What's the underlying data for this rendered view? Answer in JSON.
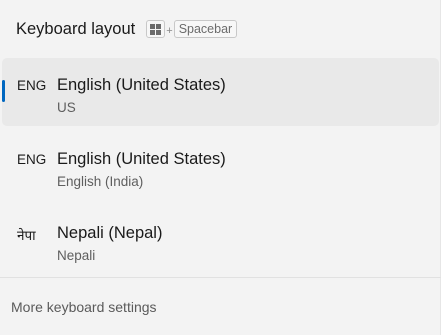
{
  "header": {
    "title": "Keyboard layout",
    "shortcut_plus": "+",
    "shortcut_key": "Spacebar"
  },
  "layouts": [
    {
      "code": "ENG",
      "name": "English (United States)",
      "sub": "US",
      "selected": true
    },
    {
      "code": "ENG",
      "name": "English (United States)",
      "sub": "English (India)",
      "selected": false
    },
    {
      "code": "नेपा",
      "name": "Nepali (Nepal)",
      "sub": "Nepali",
      "selected": false
    }
  ],
  "footer": {
    "more_settings": "More keyboard settings"
  },
  "colors": {
    "accent": "#0067c0",
    "background": "#f3f3f3",
    "selected_bg": "#e9e9e9"
  },
  "icons": {
    "shortcut_modifier": "windows-logo-icon"
  }
}
